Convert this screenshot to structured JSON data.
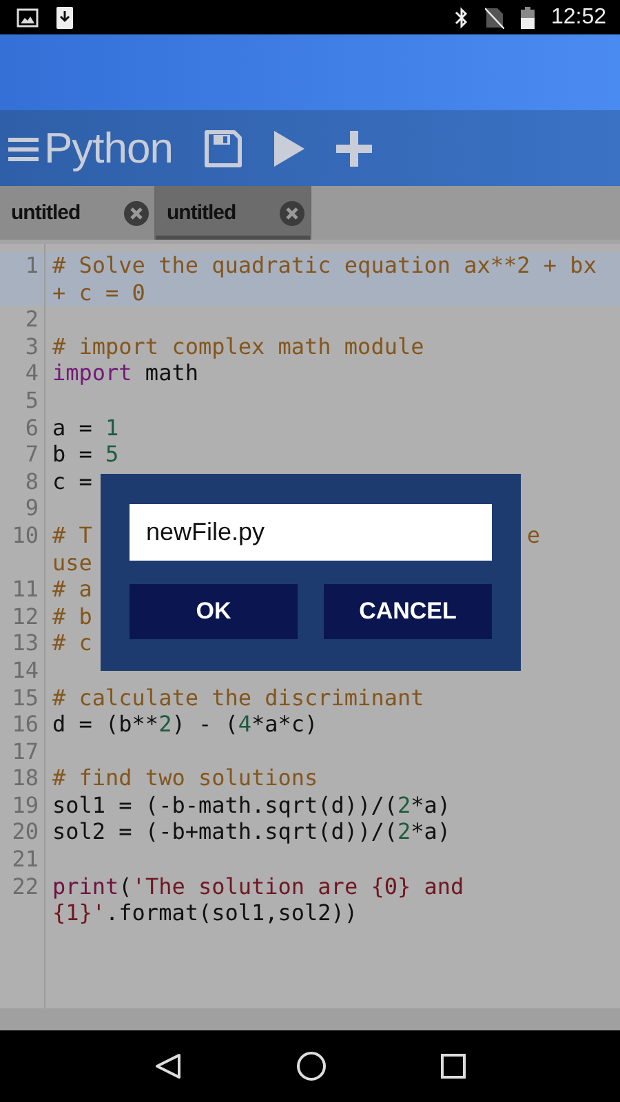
{
  "status_bar": {
    "time": "12:52"
  },
  "toolbar": {
    "title": "Python"
  },
  "tabs": [
    {
      "label": "untitled",
      "selected": false
    },
    {
      "label": "untitled",
      "selected": true
    }
  ],
  "editor": {
    "lines": [
      {
        "n": "1",
        "highlighted": true,
        "rows": [
          {
            "tokens": [
              {
                "kind": "comment",
                "text": "# Solve the quadratic equation ax**2 + bx + c = 0"
              }
            ]
          }
        ]
      },
      {
        "n": "2",
        "highlighted": false,
        "rows": [
          {
            "tokens": []
          }
        ]
      },
      {
        "n": "3",
        "highlighted": false,
        "rows": [
          {
            "tokens": [
              {
                "kind": "comment",
                "text": "# import complex math module"
              }
            ]
          }
        ]
      },
      {
        "n": "4",
        "highlighted": false,
        "rows": [
          {
            "tokens": [
              {
                "kind": "keyword",
                "text": "import"
              },
              {
                "kind": "plain",
                "text": " math"
              }
            ]
          }
        ]
      },
      {
        "n": "5",
        "highlighted": false,
        "rows": [
          {
            "tokens": []
          }
        ]
      },
      {
        "n": "6",
        "highlighted": false,
        "rows": [
          {
            "tokens": [
              {
                "kind": "plain",
                "text": "a = "
              },
              {
                "kind": "number",
                "text": "1"
              }
            ]
          }
        ]
      },
      {
        "n": "7",
        "highlighted": false,
        "rows": [
          {
            "tokens": [
              {
                "kind": "plain",
                "text": "b = "
              },
              {
                "kind": "number",
                "text": "5"
              }
            ]
          }
        ]
      },
      {
        "n": "8",
        "highlighted": false,
        "rows": [
          {
            "tokens": [
              {
                "kind": "plain",
                "text": "c ="
              }
            ]
          }
        ]
      },
      {
        "n": "9",
        "highlighted": false,
        "rows": [
          {
            "tokens": []
          }
        ]
      },
      {
        "n": "10",
        "highlighted": false,
        "rows": [
          {
            "tokens": [
              {
                "kind": "comment",
                "text": "# T"
              }
            ],
            "tail": [
              {
                "kind": "comment",
                "text": "e"
              }
            ]
          },
          {
            "tokens": [
              {
                "kind": "comment",
                "text": "use"
              }
            ]
          }
        ]
      },
      {
        "n": "11",
        "highlighted": false,
        "rows": [
          {
            "tokens": [
              {
                "kind": "comment",
                "text": "# a"
              }
            ]
          }
        ]
      },
      {
        "n": "12",
        "highlighted": false,
        "rows": [
          {
            "tokens": [
              {
                "kind": "comment",
                "text": "# b"
              }
            ]
          }
        ]
      },
      {
        "n": "13",
        "highlighted": false,
        "rows": [
          {
            "tokens": [
              {
                "kind": "comment",
                "text": "# c"
              }
            ]
          }
        ]
      },
      {
        "n": "14",
        "highlighted": false,
        "rows": [
          {
            "tokens": []
          }
        ]
      },
      {
        "n": "15",
        "highlighted": false,
        "rows": [
          {
            "tokens": [
              {
                "kind": "comment",
                "text": "# calculate the discriminant"
              }
            ]
          }
        ]
      },
      {
        "n": "16",
        "highlighted": false,
        "rows": [
          {
            "tokens": [
              {
                "kind": "plain",
                "text": "d = (b**"
              },
              {
                "kind": "number",
                "text": "2"
              },
              {
                "kind": "plain",
                "text": ") - ("
              },
              {
                "kind": "number",
                "text": "4"
              },
              {
                "kind": "plain",
                "text": "*a*c)"
              }
            ]
          }
        ]
      },
      {
        "n": "17",
        "highlighted": false,
        "rows": [
          {
            "tokens": []
          }
        ]
      },
      {
        "n": "18",
        "highlighted": false,
        "rows": [
          {
            "tokens": [
              {
                "kind": "comment",
                "text": "# find two solutions"
              }
            ]
          }
        ]
      },
      {
        "n": "19",
        "highlighted": false,
        "rows": [
          {
            "tokens": [
              {
                "kind": "plain",
                "text": "sol1 = (-b-math.sqrt(d))/("
              },
              {
                "kind": "number",
                "text": "2"
              },
              {
                "kind": "plain",
                "text": "*a)"
              }
            ]
          }
        ]
      },
      {
        "n": "20",
        "highlighted": false,
        "rows": [
          {
            "tokens": [
              {
                "kind": "plain",
                "text": "sol2 = (-b+math.sqrt(d))/("
              },
              {
                "kind": "number",
                "text": "2"
              },
              {
                "kind": "plain",
                "text": "*a)"
              }
            ]
          }
        ]
      },
      {
        "n": "21",
        "highlighted": false,
        "rows": [
          {
            "tokens": []
          }
        ]
      },
      {
        "n": "22",
        "highlighted": false,
        "rows": [
          {
            "tokens": [
              {
                "kind": "keyword2",
                "text": "print"
              },
              {
                "kind": "plain",
                "text": "("
              },
              {
                "kind": "string",
                "text": "'The solution are {0} and {1}'"
              },
              {
                "kind": "plain",
                "text": ".format(sol1,sol2))"
              }
            ]
          }
        ]
      }
    ]
  },
  "dialog": {
    "value": "newFile.py",
    "buttons": [
      "OK",
      "CANCEL"
    ]
  }
}
